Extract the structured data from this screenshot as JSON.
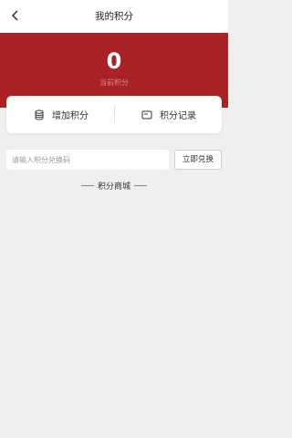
{
  "header": {
    "title": "我的积分"
  },
  "summary": {
    "points": "0",
    "label": "当前积分"
  },
  "actions": {
    "add": {
      "label": "增加积分",
      "icon": "coins-stack-icon"
    },
    "records": {
      "label": "积分记录",
      "icon": "card-icon"
    }
  },
  "redeem": {
    "placeholder": "请输入积分兑换码",
    "button": "立即兑换"
  },
  "section": {
    "title": "积分商城"
  },
  "colors": {
    "banner": "#a92225",
    "background": "#efefef"
  }
}
